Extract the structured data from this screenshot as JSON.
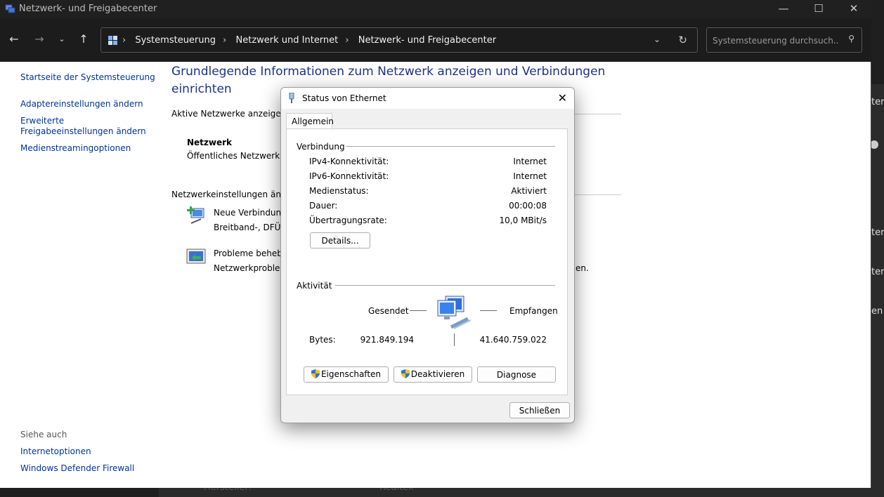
{
  "window": {
    "title": "Netzwerk- und Freigabecenter"
  },
  "breadcrumb": [
    "Systemsteuerung",
    "Netzwerk und Internet",
    "Netzwerk- und Freigabecenter"
  ],
  "search": {
    "placeholder": "Systemsteuerung durchsuch..."
  },
  "sidebar": {
    "home": "Startseite der Systemsteuerung",
    "items": [
      "Adaptereinstellungen ändern",
      "Erweiterte Freigabeeinstellungen ändern",
      "Medienstreamingoptionen"
    ],
    "see_also_heading": "Siehe auch",
    "see_also": [
      "Internetoptionen",
      "Windows Defender Firewall"
    ]
  },
  "main": {
    "title": "Grundlegende Informationen zum Netzwerk anzeigen und Verbindungen einrichten",
    "active_networks_heading": "Aktive Netzwerke anzeigen",
    "network_name": "Netzwerk",
    "network_type": "Öffentliches Netzwerk",
    "settings_heading": "Netzwerkeinstellungen änder",
    "new_connection_link": "Neue Verbindung",
    "new_connection_desc": "Breitband-, DFÜ- o",
    "troubleshoot_link": "Probleme behebe",
    "troubleshoot_desc": "Netzwerkproblem",
    "troubleshoot_tail": "en."
  },
  "background": {
    "edge_texts": [
      "ter",
      "ter",
      "ter",
      "en"
    ],
    "footer_left": "Hersteller:",
    "footer_right": "Realtek"
  },
  "dialog": {
    "title": "Status von Ethernet",
    "tab": "Allgemein",
    "connection_heading": "Verbindung",
    "rows": [
      {
        "label": "IPv4-Konnektivität:",
        "value": "Internet"
      },
      {
        "label": "IPv6-Konnektivität:",
        "value": "Internet"
      },
      {
        "label": "Medienstatus:",
        "value": "Aktiviert"
      },
      {
        "label": "Dauer:",
        "value": "00:00:08"
      },
      {
        "label": "Übertragungsrate:",
        "value": "10,0 MBit/s"
      }
    ],
    "details_button": "Details...",
    "activity_heading": "Aktivität",
    "sent_label": "Gesendet",
    "received_label": "Empfangen",
    "bytes_label": "Bytes:",
    "bytes_sent": "921.849.194",
    "bytes_received": "41.640.759.022",
    "properties_button": "Eigenschaften",
    "disable_button": "Deaktivieren",
    "diagnose_button": "Diagnose",
    "close_button": "Schließen"
  },
  "colors": {
    "link": "#003399",
    "title": "#1e3287",
    "dark_chrome": "#1c1c1c"
  }
}
